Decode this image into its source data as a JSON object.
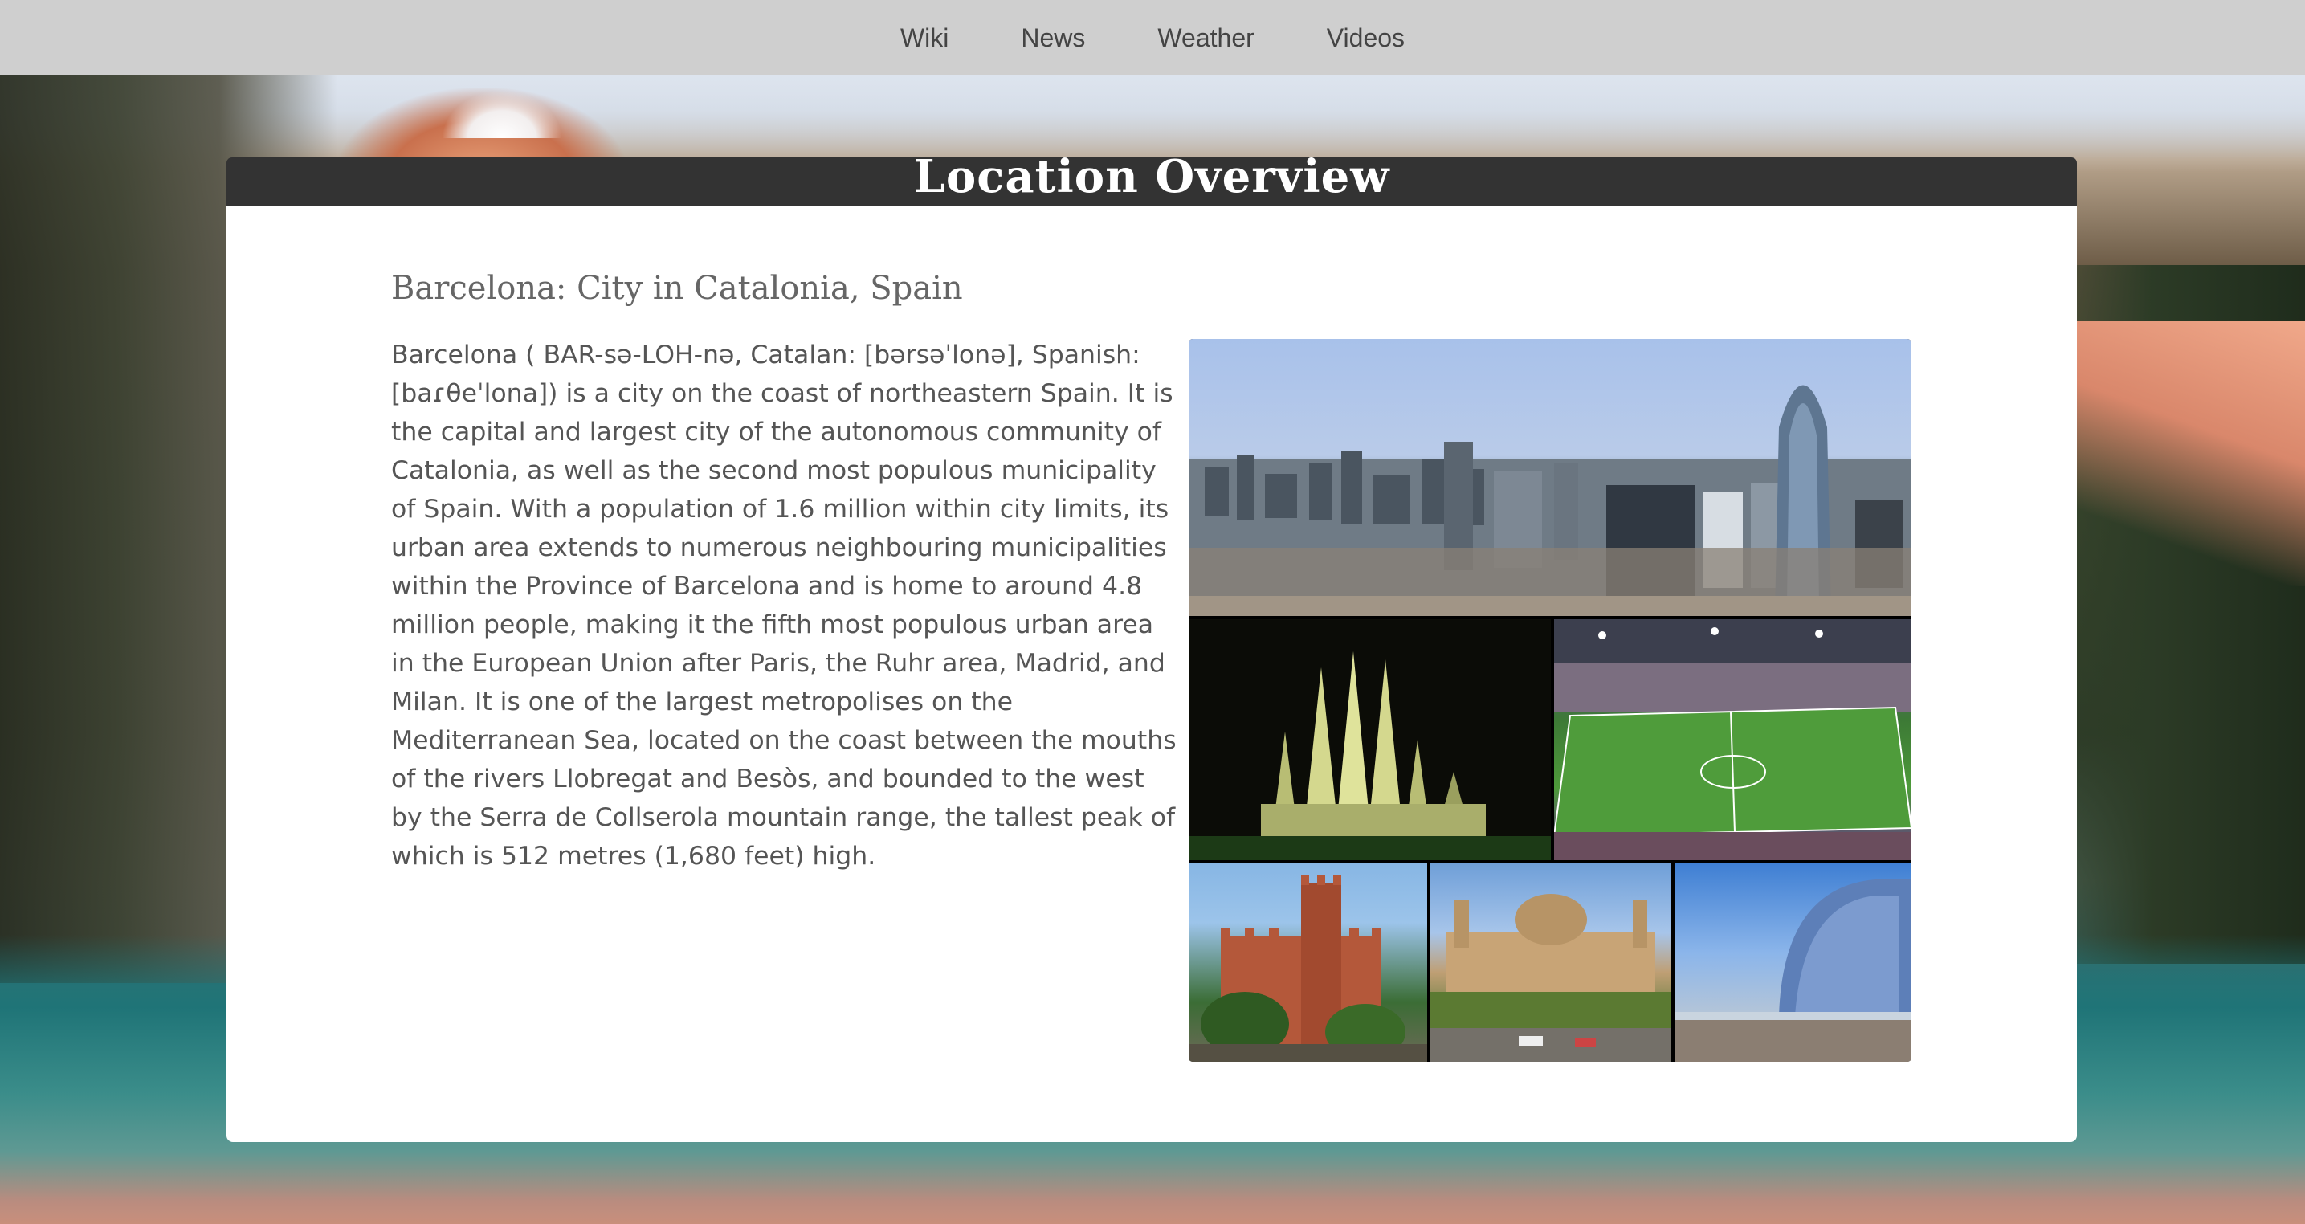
{
  "nav": {
    "items": [
      {
        "label": "Wiki"
      },
      {
        "label": "News"
      },
      {
        "label": "Weather"
      },
      {
        "label": "Videos"
      }
    ]
  },
  "overview": {
    "title": "Location Overview"
  },
  "location": {
    "heading": "Barcelona: City in Catalonia, Spain",
    "description": "Barcelona ( BAR-sə-LOH-nə, Catalan: [bərsəˈlonə], Spanish: [baɾθeˈlona]) is a city on the coast of northeastern Spain. It is the capital and largest city of the autonomous community of Catalonia, as well as the second most populous municipality of Spain. With a population of 1.6 million within city limits, its urban area extends to numerous neighbouring municipalities within the Province of Barcelona and is home to around 4.8 million people, making it the fifth most populous urban area in the European Union after Paris, the Ruhr area, Madrid, and Milan. It is one of the largest metropolises on the Mediterranean Sea, located on the coast between the mouths of the rivers Llobregat and Besòs, and bounded to the west by the Serra de Collserola mountain range, the tallest peak of which is 512 metres (1,680 feet) high."
  }
}
